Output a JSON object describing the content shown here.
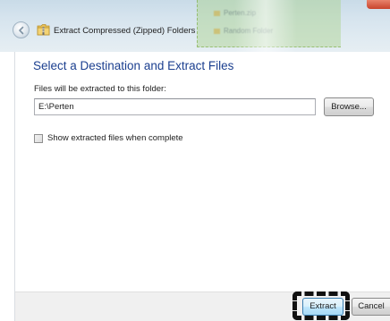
{
  "window": {
    "title": "Extract Compressed (Zipped) Folders",
    "background_files": [
      "Perten.zip",
      "Random Folder"
    ]
  },
  "icons": {
    "back": "back-arrow-icon",
    "folder": "zipped-folder-icon"
  },
  "main": {
    "heading": "Select a Destination and Extract Files",
    "destination_label": "Files will be extracted to this folder:",
    "destination_value": "E:\\Perten",
    "browse_label": "Browse...",
    "show_files_label": "Show extracted files when complete",
    "show_files_checked": false
  },
  "footer": {
    "extract_label": "Extract",
    "cancel_label": "Cancel"
  },
  "colors": {
    "heading": "#1b3f8f",
    "highlight": "#111111",
    "default_button": "#3c7fb1"
  }
}
